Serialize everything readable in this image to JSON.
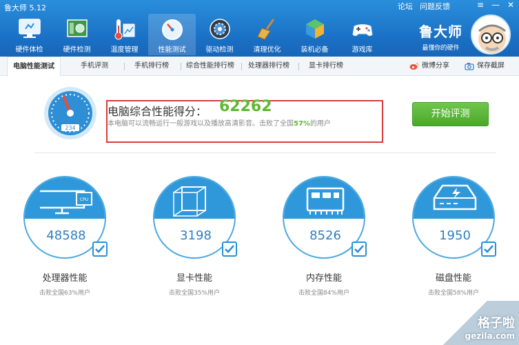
{
  "window": {
    "title": "鲁大师 5.12",
    "links": [
      "论坛",
      "问题反馈"
    ],
    "controls": [
      "≡",
      "—",
      "✕"
    ]
  },
  "nav": [
    {
      "label": "硬件体检",
      "icon": "monitor-icon"
    },
    {
      "label": "硬件检测",
      "icon": "motherboard-icon"
    },
    {
      "label": "温度管理",
      "icon": "thermometer-icon"
    },
    {
      "label": "性能测试",
      "icon": "speedometer-icon"
    },
    {
      "label": "驱动检测",
      "icon": "gear-cd-icon"
    },
    {
      "label": "清理优化",
      "icon": "broom-icon"
    },
    {
      "label": "装机必备",
      "icon": "cube-icon"
    },
    {
      "label": "游戏库",
      "icon": "gamepad-icon"
    }
  ],
  "brand": {
    "name": "鲁大师",
    "slogan": "最懂你的硬件"
  },
  "tabs": [
    "电脑性能测试",
    "手机评测",
    "手机排行榜",
    "综合性能排行榜",
    "处理器排行榜",
    "显卡排行榜"
  ],
  "tab_actions": {
    "share": "微博分享",
    "screenshot": "保存截屏"
  },
  "score": {
    "gauge_value": "234",
    "label": "电脑综合性能得分：",
    "value": "62262",
    "desc_prefix": "本电脑可以流畅运行一般游戏以及播放高清影音。击败了全国",
    "desc_pct": "57%",
    "desc_suffix": "的用户"
  },
  "start_button": "开始评测",
  "components": [
    {
      "value": "48588",
      "label": "处理器性能",
      "sub": "击败全国63%用户",
      "icon": "cpu-monitor-icon"
    },
    {
      "value": "3198",
      "label": "显卡性能",
      "sub": "击败全国35%用户",
      "icon": "gpu-cube-icon"
    },
    {
      "value": "8526",
      "label": "内存性能",
      "sub": "击败全国84%用户",
      "icon": "memory-chip-icon"
    },
    {
      "value": "1950",
      "label": "磁盘性能",
      "sub": "击败全国58%用户",
      "icon": "hard-disk-icon"
    }
  ],
  "watermark": {
    "cn": "格子啦",
    "url": "gezila.com"
  },
  "colors": {
    "header": "#1a6fc4",
    "accent": "#2a8fd4",
    "score_green": "#5fb832",
    "box_red": "#d93a3a"
  }
}
